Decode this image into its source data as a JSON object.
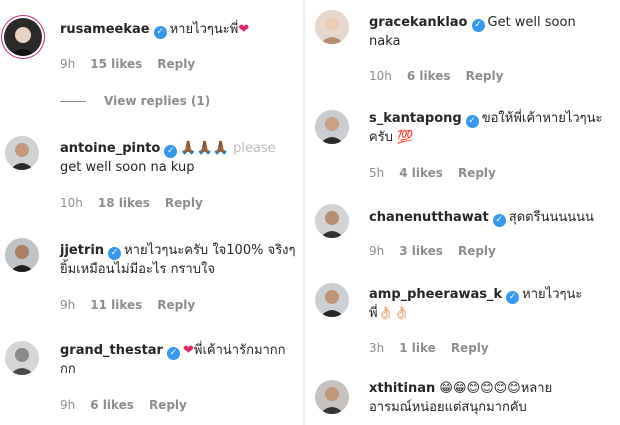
{
  "left": {
    "comments": [
      {
        "username": "rusameekae",
        "text": "หายไวๆนะพี่",
        "emoji": "❤",
        "time": "9h",
        "likes": "15 likes",
        "reply": "Reply",
        "view_replies": "View replies (1)"
      },
      {
        "username": "antoine_pinto",
        "text": "please",
        "emoji": "🙏🏾🙏🏾🙏🏾",
        "text2": "get well soon na kup",
        "time": "10h",
        "likes": "18 likes",
        "reply": "Reply"
      },
      {
        "username": "jjetrin",
        "text": "หายไวๆนะครับ ใจ100% จริงๆ",
        "text2": "ยิ้มเหมือนไม่มีอะไร กราบใจ",
        "time": "9h",
        "likes": "11 likes",
        "reply": "Reply"
      },
      {
        "username": "grand_thestar",
        "emoji": "❤",
        "text": "พี่เค้าน่ารักมากก",
        "text2": "กก",
        "time": "9h",
        "likes": "6 likes",
        "reply": "Reply"
      }
    ]
  },
  "right": {
    "comments": [
      {
        "username": "gracekanklao",
        "text": "Get well soon",
        "text2": "naka",
        "time": "10h",
        "likes": "6 likes",
        "reply": "Reply"
      },
      {
        "username": "s_kantapong",
        "text": "ขอให้พี่เค้าหายไวๆนะ",
        "text2": "ครับ",
        "emoji": "💯",
        "time": "5h",
        "likes": "4 likes",
        "reply": "Reply"
      },
      {
        "username": "chanenutthawat",
        "text": "สุดตรีนนนนนน",
        "time": "9h",
        "likes": "3 likes",
        "reply": "Reply"
      },
      {
        "username": "amp_pheerawas_k",
        "text": "หายไวๆนะ",
        "text2": "พี่",
        "emoji": "👌🏻👌🏻",
        "time": "3h",
        "likes": "1 like",
        "reply": "Reply"
      },
      {
        "username": "xthitinan",
        "emoji": "😁😁😊😊😊😊",
        "text": "หลาย",
        "text2": "อารมณ์หน่อยแต่สนุกมากคับ"
      }
    ]
  },
  "colors": {
    "verified": "#3897f0",
    "meta": "#8e8e8e",
    "text": "#262626"
  }
}
